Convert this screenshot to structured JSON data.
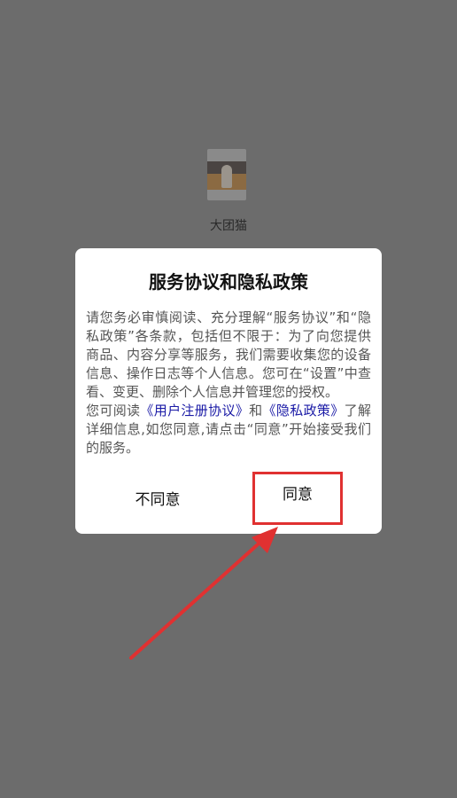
{
  "app": {
    "name": "大团猫",
    "logo_icon": "app-logo-icon"
  },
  "dialog": {
    "title": "服务协议和隐私政策",
    "body_text": "请您务必审慎阅读、充分理解“服务协议”和“隐私政策”各条款，包括但不限于：为了向您提供商品、内容分享等服务，我们需要收集您的设备信息、操作日志等个人信息。您可在“设置”中查看、变更、删除个人信息并管理您的授权。",
    "read_prefix": "您可阅读",
    "user_agreement_link": "《用户注册协议》",
    "and_text": "和",
    "privacy_policy_link": "《隐私政策》",
    "read_suffix": "了解详细信息,如您同意,请点击“同意”开始接受我们的服务。",
    "disagree_label": "不同意",
    "agree_label": "同意"
  },
  "colors": {
    "overlay": "#6c6c6c",
    "link": "#1a1aa6",
    "highlight": "#e03131"
  }
}
